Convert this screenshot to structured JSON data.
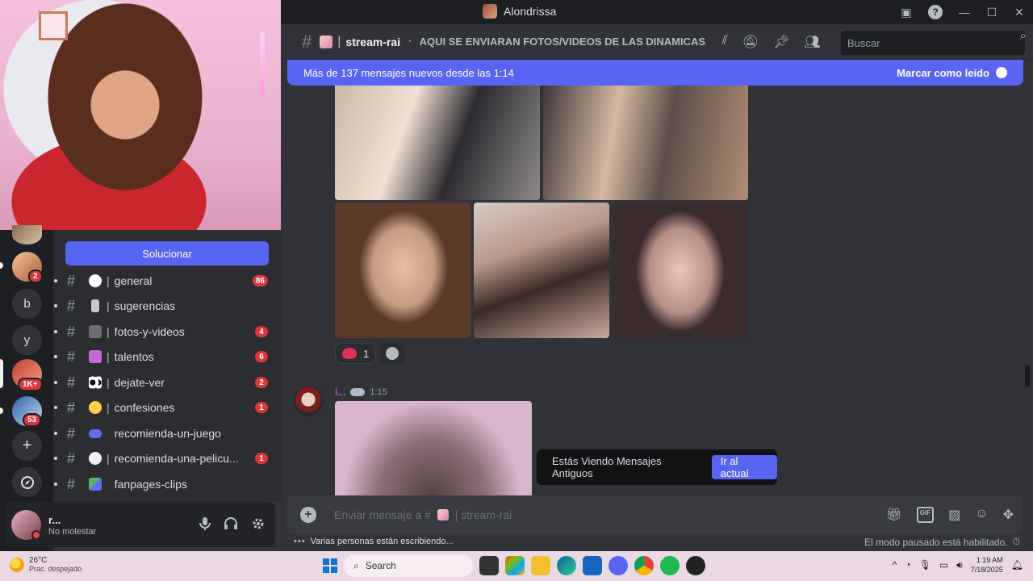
{
  "window": {
    "title": "Alondrissa"
  },
  "servers": {
    "items": [
      {
        "label": "",
        "badge": "2"
      },
      {
        "label": "b",
        "badge": ""
      },
      {
        "label": "y",
        "badge": ""
      },
      {
        "label": "",
        "badge": "1K+"
      },
      {
        "label": "",
        "badge": "53"
      }
    ],
    "add_icon": "+",
    "explore_icon": "compass-icon"
  },
  "channel_list": {
    "fix_button": "Solucionar",
    "channels": [
      {
        "name": "general",
        "badge": "86",
        "emoji_color": "#ffffff"
      },
      {
        "name": "sugerencias",
        "badge": "",
        "emoji_color": "#c8c8c8"
      },
      {
        "name": "fotos-y-videos",
        "badge": "4",
        "emoji_color": "#6d6d6d"
      },
      {
        "name": "talentos",
        "badge": "6",
        "emoji_color": "#c06bd6"
      },
      {
        "name": "dejate-ver",
        "badge": "2",
        "emoji_color": "#ffffff"
      },
      {
        "name": "confesiones",
        "badge": "1",
        "emoji_color": "#ffcc4d"
      },
      {
        "name": "recomienda-un-juego",
        "badge": "",
        "emoji_color": "#5d6ff0"
      },
      {
        "name": "recomienda-una-pelicu...",
        "badge": "1",
        "emoji_color": "#f0f0f0"
      },
      {
        "name": "fanpages-clips",
        "badge": "",
        "emoji_color": "#58b368"
      }
    ]
  },
  "user": {
    "name": "r...",
    "status": "No molestar"
  },
  "header": {
    "channel": "stream-rai",
    "topic": "AQUI SE ENVIARAN FOTOS/VIDEOS DE LAS DINAMICAS DE...",
    "search_placeholder": "Buscar"
  },
  "new_messages": {
    "text": "Más de 137 mensajes nuevos desde las 1:14",
    "mark_read": "Marcar como leído"
  },
  "messages": {
    "reaction_count": "1",
    "second_author": "i...",
    "second_time": "1:15"
  },
  "jump": {
    "text": "Estás Viendo Mensajes Antiguos",
    "button": "Ir al actual"
  },
  "composer": {
    "placeholder_prefix": "Enviar mensaje a #",
    "placeholder_channel": "| stream-rai",
    "gif_label": "GIF"
  },
  "status_bar": {
    "typing": "Varias personas están escribiendo...",
    "paused": "El modo pausado está habilitado."
  },
  "taskbar": {
    "temperature": "26°C",
    "weather": "Prac. despejado",
    "search": "Search",
    "time": "1:19 AM",
    "date": "7/18/2025"
  },
  "colors": {
    "accent": "#5865f2",
    "badge": "#da373c",
    "background": "#313338",
    "sidebar": "#2b2d31"
  }
}
